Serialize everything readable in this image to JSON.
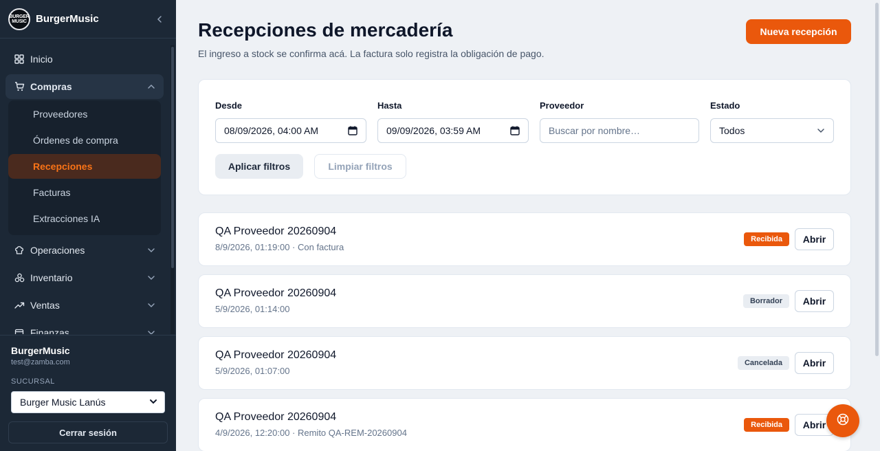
{
  "sidebar": {
    "brand_name": "BurgerMusic",
    "logo_text": "BURGER MUSIC",
    "nav": [
      {
        "label": "Inicio",
        "icon": "grid-icon"
      },
      {
        "label": "Compras",
        "icon": "cart-icon"
      },
      {
        "label": "Operaciones",
        "icon": "chef-hat-icon"
      },
      {
        "label": "Inventario",
        "icon": "boxes-icon"
      },
      {
        "label": "Ventas",
        "icon": "trending-up-icon"
      },
      {
        "label": "Finanzas",
        "icon": "wallet-icon"
      }
    ],
    "compras_sub": [
      {
        "label": "Proveedores"
      },
      {
        "label": "Órdenes de compra"
      },
      {
        "label": "Recepciones"
      },
      {
        "label": "Facturas"
      },
      {
        "label": "Extracciones IA"
      }
    ],
    "user_name": "BurgerMusic",
    "user_email": "test@zamba.com",
    "branch_label": "SUCURSAL",
    "branch_value": "Burger Music Lanús",
    "logout_label": "Cerrar sesión"
  },
  "header": {
    "title": "Recepciones de mercadería",
    "subtitle": "El ingreso a stock se confirma acá. La factura solo registra la obligación de pago.",
    "new_button": "Nueva recepción"
  },
  "filters": {
    "desde_label": "Desde",
    "desde_value": "08/09/2026, 04:00 AM",
    "hasta_label": "Hasta",
    "hasta_value": "09/09/2026, 03:59 AM",
    "proveedor_label": "Proveedor",
    "proveedor_placeholder": "Buscar por nombre…",
    "estado_label": "Estado",
    "estado_value": "Todos",
    "apply_label": "Aplicar filtros",
    "clear_label": "Limpiar filtros"
  },
  "receptions": [
    {
      "supplier": "QA Proveedor 20260904",
      "meta": "8/9/2026, 01:19:00 · Con factura",
      "status": "Recibida",
      "action": "Abrir"
    },
    {
      "supplier": "QA Proveedor 20260904",
      "meta": "5/9/2026, 01:14:00",
      "status": "Borrador",
      "action": "Abrir"
    },
    {
      "supplier": "QA Proveedor 20260904",
      "meta": "5/9/2026, 01:07:00",
      "status": "Cancelada",
      "action": "Abrir"
    },
    {
      "supplier": "QA Proveedor 20260904",
      "meta": "4/9/2026, 12:20:00 · Remito QA-REM-20260904",
      "status": "Recibida",
      "action": "Abrir"
    }
  ],
  "colors": {
    "accent": "#ea580c",
    "sidebar_bg": "#1c2836",
    "page_bg": "#eef1f5"
  }
}
